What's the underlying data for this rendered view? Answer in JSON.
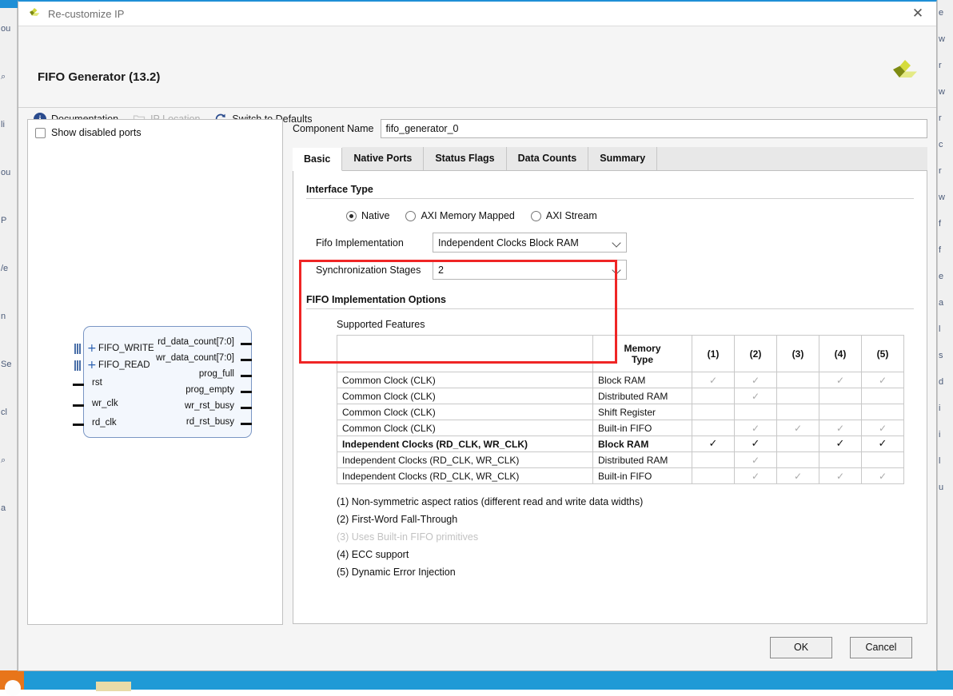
{
  "window": {
    "title": "Re-customize IP",
    "close_label": "✕",
    "logo_name": "xilinx-logo"
  },
  "header": {
    "ip_title": "FIFO Generator (13.2)",
    "toolbar": [
      {
        "label": "Documentation",
        "icon": "info-icon",
        "disabled": false
      },
      {
        "label": "IP Location",
        "icon": "folder-icon",
        "disabled": true
      },
      {
        "label": "Switch to Defaults",
        "icon": "refresh-icon",
        "disabled": false
      }
    ]
  },
  "left_panel": {
    "show_disabled_ports_label": "Show disabled ports",
    "show_disabled_ports_checked": false,
    "symbol": {
      "bus_ports": [
        "FIFO_WRITE",
        "FIFO_READ"
      ],
      "inputs": [
        "rst",
        "wr_clk",
        "rd_clk"
      ],
      "outputs": [
        "rd_data_count[7:0]",
        "wr_data_count[7:0]",
        "prog_full",
        "prog_empty",
        "wr_rst_busy",
        "rd_rst_busy"
      ]
    }
  },
  "component": {
    "name_label": "Component Name",
    "name_value": "fifo_generator_0",
    "name_placeholder": "Component Name"
  },
  "tabs": [
    {
      "label": "Basic",
      "active": true
    },
    {
      "label": "Native Ports",
      "active": false
    },
    {
      "label": "Status Flags",
      "active": false
    },
    {
      "label": "Data Counts",
      "active": false
    },
    {
      "label": "Summary",
      "active": false
    }
  ],
  "interface_type": {
    "group_title": "Interface Type",
    "radios": [
      {
        "label": "Native",
        "selected": true
      },
      {
        "label": "AXI Memory Mapped",
        "selected": false
      },
      {
        "label": "AXI Stream",
        "selected": false
      }
    ],
    "fifo_implementation": {
      "label": "Fifo Implementation",
      "value": "Independent Clocks Block RAM"
    },
    "synchronization_stages": {
      "label": "Synchronization Stages",
      "value": "2"
    },
    "highlight_color": "#ef2525"
  },
  "implementation_options": {
    "group_title": "FIFO Implementation Options",
    "table_label": "Supported Features",
    "columns": [
      "",
      "Memory\nType",
      "(1)",
      "(2)",
      "(3)",
      "(4)",
      "(5)"
    ],
    "memory_header_line1": "Memory",
    "memory_header_line2": "Type",
    "num_headers": [
      "(1)",
      "(2)",
      "(3)",
      "(4)",
      "(5)"
    ],
    "rows": [
      {
        "feature": "Common Clock (CLK)",
        "memory": "Block RAM",
        "marks": [
          1,
          1,
          0,
          1,
          1
        ],
        "highlighted": false
      },
      {
        "feature": "Common Clock (CLK)",
        "memory": "Distributed RAM",
        "marks": [
          0,
          1,
          0,
          0,
          0
        ],
        "highlighted": false
      },
      {
        "feature": "Common Clock (CLK)",
        "memory": "Shift Register",
        "marks": [
          0,
          0,
          0,
          0,
          0
        ],
        "highlighted": false
      },
      {
        "feature": "Common Clock (CLK)",
        "memory": "Built-in FIFO",
        "marks": [
          0,
          1,
          1,
          1,
          1
        ],
        "highlighted": false
      },
      {
        "feature": "Independent Clocks (RD_CLK, WR_CLK)",
        "memory": "Block RAM",
        "marks": [
          1,
          1,
          0,
          1,
          1
        ],
        "highlighted": true
      },
      {
        "feature": "Independent Clocks (RD_CLK, WR_CLK)",
        "memory": "Distributed RAM",
        "marks": [
          0,
          1,
          0,
          0,
          0
        ],
        "highlighted": false
      },
      {
        "feature": "Independent Clocks (RD_CLK, WR_CLK)",
        "memory": "Built-in FIFO",
        "marks": [
          0,
          1,
          1,
          1,
          1
        ],
        "highlighted": false
      }
    ],
    "check_glyph": "✓",
    "footnotes": [
      {
        "text": "(1) Non-symmetric aspect ratios (different read and write data widths)",
        "muted": false
      },
      {
        "text": "(2) First-Word Fall-Through",
        "muted": false
      },
      {
        "text": "(3) Uses Built-in FIFO primitives",
        "muted": true
      },
      {
        "text": "(4) ECC support",
        "muted": false
      },
      {
        "text": "(5) Dynamic Error Injection",
        "muted": false
      }
    ]
  },
  "footer": {
    "ok_label": "OK",
    "cancel_label": "Cancel"
  },
  "background": {
    "left_fragments": [
      "ou",
      "⌕",
      "li",
      "ou",
      "P",
      "/e",
      "n",
      "Se",
      "cl",
      "⌕",
      "a"
    ],
    "right_fragments": [
      "e",
      "w",
      "r",
      "w",
      "r",
      "c",
      "r",
      "w",
      "f",
      "f",
      "e",
      "a",
      "l",
      "s",
      "d",
      "i",
      "i",
      "l",
      "u"
    ]
  }
}
